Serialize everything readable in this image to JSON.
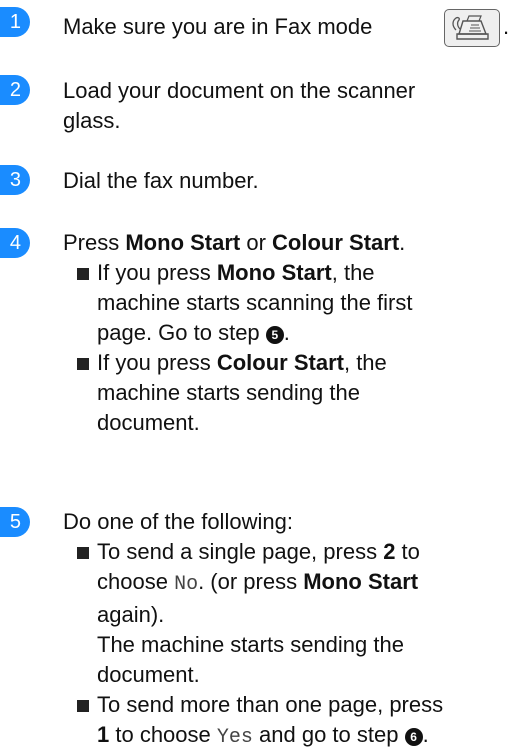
{
  "steps": [
    {
      "number": "1",
      "text": "Make sure you are in Fax mode",
      "after_icon": "."
    },
    {
      "number": "2",
      "line1": "Load your document on the scanner",
      "line2": "glass."
    },
    {
      "number": "3",
      "text": "Dial the fax number."
    },
    {
      "number": "4",
      "intro": {
        "pre": "Press ",
        "mono_start": "Mono Start",
        "or": " or ",
        "colour_start": "Colour Start",
        "end": "."
      },
      "bullets": [
        {
          "l1_pre": "If you press ",
          "l1_bold": "Mono Start",
          "l1_post": ", the",
          "l2": "machine starts scanning the first",
          "l3_pre": "page. Go to step ",
          "l3_ref": "5",
          "l3_post": "."
        },
        {
          "l1_pre": "If you press ",
          "l1_bold": "Colour Start",
          "l1_post": ", the",
          "l2": "machine starts sending the",
          "l3": "document."
        }
      ]
    },
    {
      "number": "5",
      "intro": "Do one of the following:",
      "bullets": [
        {
          "l1_pre": "To send a single page, press ",
          "l1_bold": "2",
          "l1_post": " to",
          "l2_pre": "choose ",
          "l2_mono": "No",
          "l2_mid": ". (or press ",
          "l2_bold": "Mono Start",
          "l3": "again).",
          "l4": "The machine starts sending the",
          "l5": "document."
        },
        {
          "l1": "To send more than one page, press",
          "l2_bold": "1",
          "l2_mid": " to choose ",
          "l2_mono": "Yes",
          "l2_post": " and go to step ",
          "l2_ref": "6",
          "l2_end": "."
        }
      ]
    }
  ],
  "icons": {
    "fax_mode": "fax-machine-icon",
    "bullet": "square-bullet-icon"
  },
  "colors": {
    "step_badge": "#1a8cff",
    "text": "#111111",
    "mono": "#444444"
  }
}
